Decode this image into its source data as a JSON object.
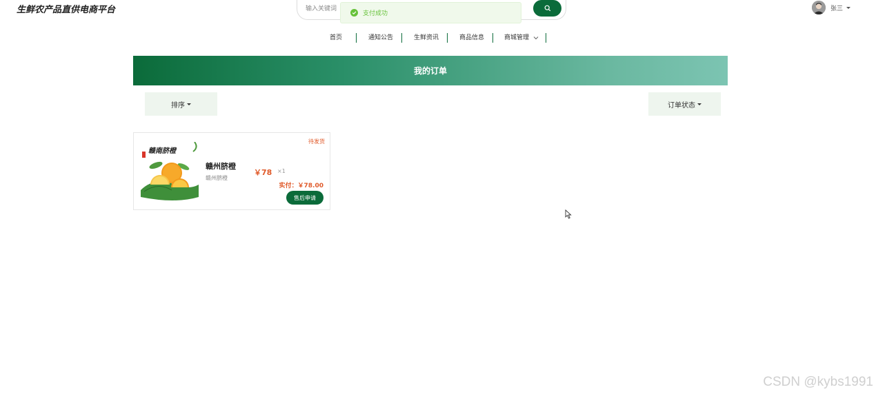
{
  "brand": {
    "title": "生鲜农产品直供电商平台"
  },
  "search": {
    "placeholder": "输入关键词"
  },
  "toast": {
    "message": "支付成功"
  },
  "user": {
    "name": "张三"
  },
  "nav": {
    "items": [
      {
        "label": "首页"
      },
      {
        "label": "通知公告"
      },
      {
        "label": "生鲜资讯"
      },
      {
        "label": "商品信息"
      },
      {
        "label": "商城管理"
      }
    ]
  },
  "banner": {
    "title": "我的订单"
  },
  "filters": {
    "sort_label": "排序",
    "status_label": "订单状态"
  },
  "orders": [
    {
      "status": "待发货",
      "image_text": "赣南脐橙",
      "name": "赣州脐橙",
      "subtitle": "赣州脐橙",
      "price": "￥78",
      "quantity": "×1",
      "paid": "实付：￥78.00",
      "action": "售后申请"
    }
  ],
  "watermark": "CSDN @kybs1991",
  "colors": {
    "primary": "#0b6b3a",
    "price": "#e05a2a",
    "success": "#67c23a"
  }
}
